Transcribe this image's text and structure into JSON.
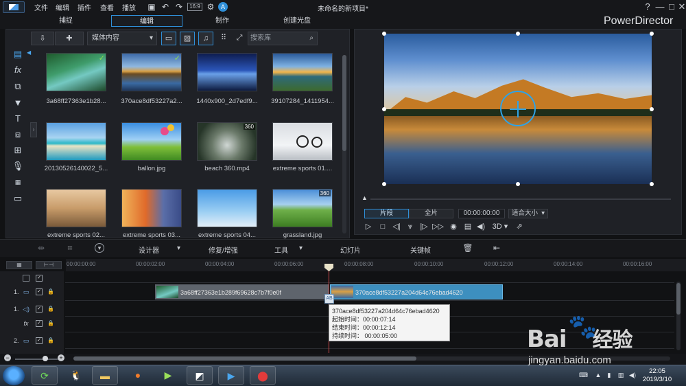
{
  "menu": [
    "文件",
    "编辑",
    "插件",
    "查看",
    "播放"
  ],
  "window_title": "未命名的新项目*",
  "window_controls": {
    "help": "?",
    "minimize": "—",
    "maximize": "□",
    "close": "✕"
  },
  "tabs": [
    {
      "label": "捕捉"
    },
    {
      "label": "编辑"
    },
    {
      "label": "制作"
    },
    {
      "label": "创建光盘"
    }
  ],
  "brand": "PowerDirector",
  "library": {
    "content_select": "媒体内容",
    "search_placeholder": "搜索库",
    "items": [
      {
        "label": "3a68ff27363e1b28...",
        "checked": true
      },
      {
        "label": "370ace8df53227a2...",
        "checked": true
      },
      {
        "label": "1440x900_2d7edf9..."
      },
      {
        "label": "39107284_1411954..."
      },
      {
        "label": "20130526140022_5..."
      },
      {
        "label": "ballon.jpg"
      },
      {
        "label": "beach 360.mp4",
        "badge": "360"
      },
      {
        "label": "extreme sports 01...."
      },
      {
        "label": "extreme sports 02..."
      },
      {
        "label": "extreme sports 03..."
      },
      {
        "label": "extreme sports 04..."
      },
      {
        "label": "grassland.jpg",
        "badge": "360"
      }
    ]
  },
  "preview": {
    "seg_clip": "片段",
    "seg_full": "全片",
    "timecode": "00:00:00:00",
    "fit": "适合大小",
    "mode_3d": "3D"
  },
  "timeline_toolbar": {
    "designer": "设计器",
    "fix_enhance": "修复/增强",
    "tools": "工具",
    "slideshow": "幻灯片",
    "keyframe": "关键帧"
  },
  "ruler_ticks": [
    "00:00:00:00",
    "00:00:02:00",
    "00:00:04:00",
    "00:00:06:00",
    "00:00:08:00",
    "00:00:10:00",
    "00:00:12:00",
    "00:00:14:00",
    "00:00:16:00"
  ],
  "tracks": [
    {
      "num": "1.",
      "type": "video"
    },
    {
      "num": "1.",
      "type": "audio"
    },
    {
      "num": "",
      "type": "fx"
    },
    {
      "num": "2.",
      "type": "video"
    }
  ],
  "clips": [
    {
      "label": "3a68ff27363e1b289f69628c7b7f0e0f"
    },
    {
      "label": "370ace8df53227a204d64c76ebad4620"
    }
  ],
  "tooltip": {
    "title": "370ace8df53227a204d64c76ebad4620",
    "start": "起始时间：00:00:07:14",
    "end": "结束时间：00:00:12:14",
    "duration": "持续时间：  00:00:05:00"
  },
  "taskbar": {
    "time": "22:05",
    "date": "2019/3/10"
  },
  "watermark": {
    "brand": "Bai",
    "brand2": "经验",
    "url": "jingyan.baidu.com"
  },
  "colors": {
    "accent": "#2f8fd8",
    "clip_selected": "#3d8fbf",
    "playhead": "#d34b4b"
  }
}
